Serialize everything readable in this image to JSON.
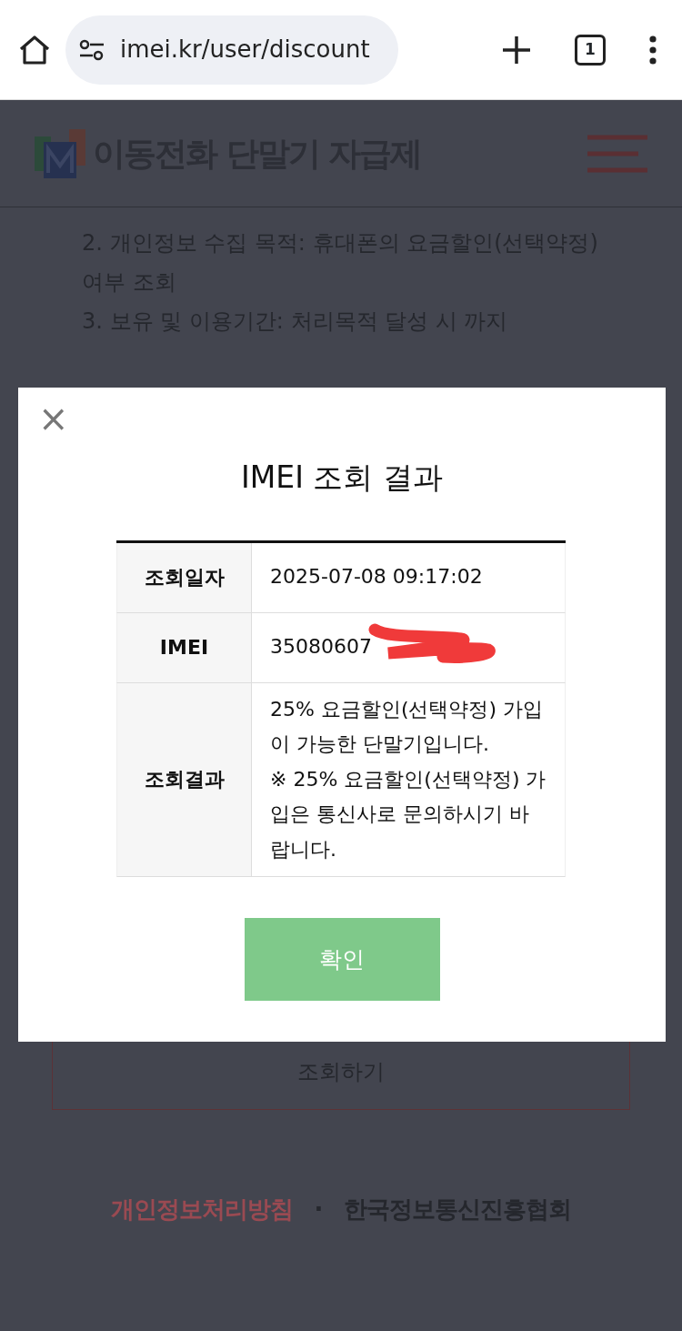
{
  "browser": {
    "url": "imei.kr/user/discount",
    "tab_count": "1"
  },
  "site": {
    "logo_text": "이동전화 단말기 자급제"
  },
  "notice_lines": [
    "2. 개인정보 수집 목적: 휴대폰의 요금할인(선택약정)",
    "여부 조회",
    "3. 보유 및 이용기간: 처리목적 달성 시 까지"
  ],
  "search_button": "조회하기",
  "footer": {
    "links": [
      "개인정보처리방침",
      "한국정보통신진흥협회"
    ],
    "separator": "·"
  },
  "modal": {
    "close": "×",
    "title": "IMEI 조회 결과",
    "rows": [
      {
        "label": "조회일자",
        "value": "2025-07-08 09:17:02"
      },
      {
        "label": "IMEI",
        "value": "35080607",
        "redacted": true
      },
      {
        "label": "조회결과",
        "value": "25% 요금할인(선택약정) 가입이 가능한 단말기입니다.\n※ 25% 요금할인(선택약정) 가입은 통신사로 문의하시기 바랍니다."
      }
    ],
    "confirm": "확인"
  }
}
